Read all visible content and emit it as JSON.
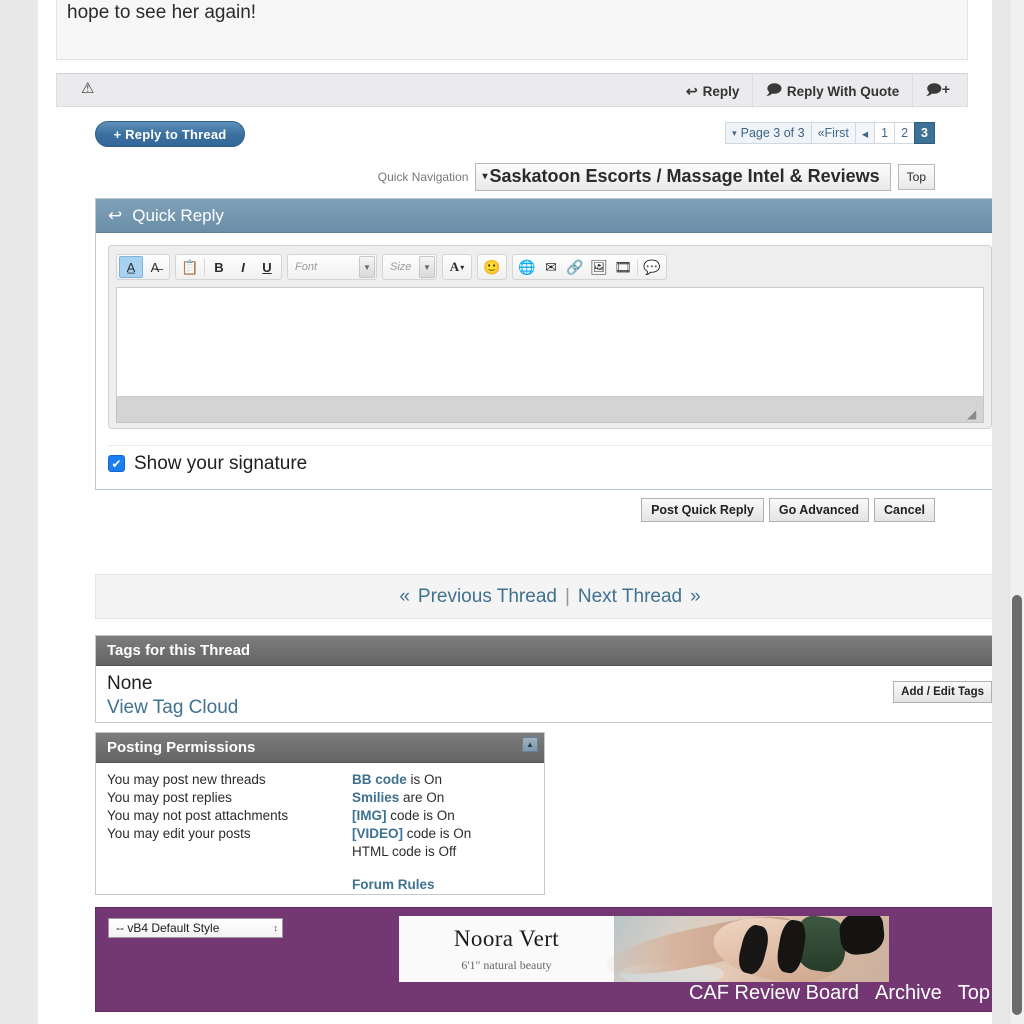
{
  "post": {
    "body_text": "hope to see her again!",
    "warn_icon": "warning-triangle",
    "controls": [
      {
        "label": "Reply",
        "icon": "reply-arrow"
      },
      {
        "label": "Reply With Quote",
        "icon": "quote-bubble"
      },
      {
        "label": "",
        "icon": "multi-quote-plus"
      }
    ]
  },
  "actions": {
    "reply_to_thread": "+ Reply to Thread"
  },
  "pagination": {
    "caret": "▾",
    "page_label": "Page 3 of 3",
    "first_label": "First",
    "first_icon": "«",
    "prev_icon": "◂",
    "pages": [
      "1",
      "2",
      "3"
    ],
    "current_page": "3"
  },
  "quick_navigation": {
    "label": "Quick Navigation",
    "selected": "Saskatoon Escorts / Massage Intel & Reviews",
    "caret": "▾",
    "top_button": "Top"
  },
  "quick_reply": {
    "title": "Quick Reply",
    "header_icon": "reply-curve-arrow",
    "toolbar": {
      "groups": [
        {
          "buttons": [
            {
              "name": "toggle-wysiwyg",
              "glyph": "A̲",
              "active": true
            },
            {
              "name": "remove-formatting",
              "glyph": "A̶",
              "active": false
            }
          ]
        },
        {
          "buttons": [
            {
              "name": "paste-clipboard",
              "glyph": "📋",
              "active": false
            },
            {
              "name": "bold",
              "glyph": "B",
              "active": false
            },
            {
              "name": "italic",
              "glyph": "I",
              "active": false
            },
            {
              "name": "underline",
              "glyph": "U",
              "active": false
            }
          ]
        }
      ],
      "font_select": {
        "placeholder": "Font"
      },
      "size_select": {
        "placeholder": "Size"
      },
      "color_button": {
        "glyph": "A",
        "caret": "▾"
      },
      "smilie_button": {
        "glyph": "🙂"
      },
      "insert_group": [
        {
          "name": "insert-link",
          "glyph": "🌐"
        },
        {
          "name": "insert-email",
          "glyph": "✉"
        },
        {
          "name": "unlink",
          "glyph": "🔗"
        },
        {
          "name": "insert-image",
          "glyph": "🖼"
        },
        {
          "name": "insert-video",
          "glyph": "🎞"
        },
        {
          "name": "wrap-quote",
          "glyph": "💬"
        }
      ]
    },
    "textarea_value": "",
    "signature_checkbox": {
      "label": "Show your signature",
      "checked": true,
      "mark": "✔"
    },
    "buttons": [
      "Post Quick Reply",
      "Go Advanced",
      "Cancel"
    ]
  },
  "thread_nav": {
    "left_chev": "«",
    "previous": "Previous Thread",
    "separator": "|",
    "next": "Next Thread",
    "right_chev": "»"
  },
  "tags": {
    "title": "Tags for this Thread",
    "value": "None",
    "view_tag_cloud": "View Tag Cloud",
    "add_edit_button": "Add / Edit Tags"
  },
  "permissions": {
    "title": "Posting Permissions",
    "collapse_icon": "▲",
    "left": [
      "You may post new threads",
      "You may post replies",
      "You may not post attachments",
      "You may edit your posts"
    ],
    "right": [
      {
        "strong": "BB code",
        "rest": " is On"
      },
      {
        "strong": "Smilies",
        "rest": " are On"
      },
      {
        "strong": "[IMG]",
        "rest": " code is On"
      },
      {
        "strong": "[VIDEO]",
        "rest": " code is On"
      },
      {
        "strong": "",
        "rest": "HTML code is Off"
      }
    ],
    "forum_rules": "Forum Rules"
  },
  "footer": {
    "style_select": {
      "value": "-- vB4 Default Style",
      "arrows": "↕"
    },
    "ad": {
      "title": "Noora Vert",
      "subtitle": "6'1\" natural beauty"
    },
    "links": [
      "CAF Review Board",
      "Archive",
      "Top"
    ],
    "background_color": "#733873"
  }
}
